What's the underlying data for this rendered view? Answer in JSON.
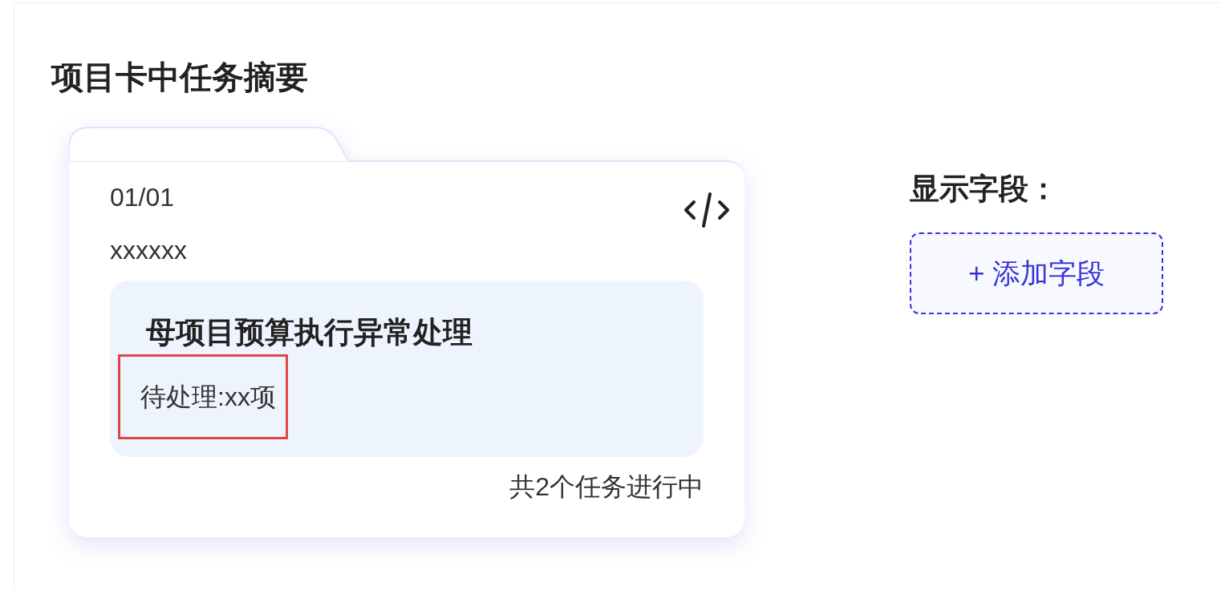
{
  "title": "项目卡中任务摘要",
  "card": {
    "index": "01/01",
    "name": "xxxxxx",
    "task": {
      "title": "母项目预算执行异常处理",
      "status": "待处理:xx项",
      "highlighted": true
    },
    "footer": "共2个任务进行中"
  },
  "fields": {
    "label": "显示字段：",
    "add_button": "+ 添加字段"
  }
}
